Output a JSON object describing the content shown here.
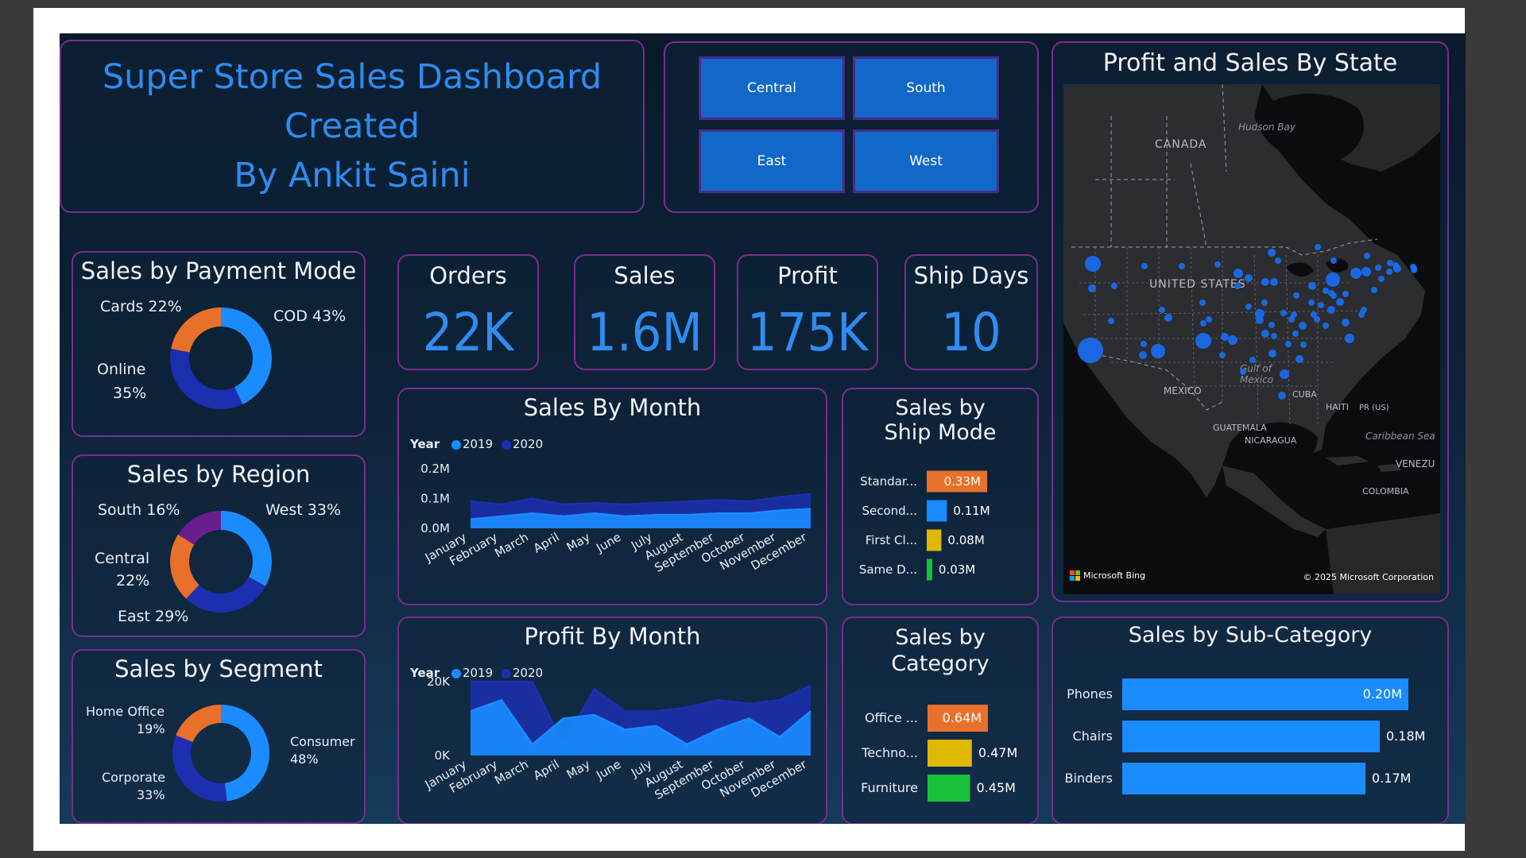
{
  "title": {
    "line1": "Super Store Sales Dashboard",
    "line2": "Created",
    "line3": "By Ankit Saini"
  },
  "region_slicer": {
    "buttons": [
      "Central",
      "South",
      "East",
      "West"
    ]
  },
  "kpis": [
    {
      "label": "Orders",
      "value": "22K"
    },
    {
      "label": "Sales",
      "value": "1.6M"
    },
    {
      "label": "Profit",
      "value": "175K"
    },
    {
      "label": "Ship Days",
      "value": "10"
    }
  ],
  "map": {
    "title": "Profit and Sales By State",
    "labels": {
      "canada": "CANADA",
      "hudson": "Hudson Bay",
      "us": "UNITED STATES",
      "gulf1": "Gulf of",
      "gulf2": "Mexico",
      "mexico": "MEXICO",
      "cuba": "CUBA",
      "haiti": "HAITI",
      "pr": "PR (US)",
      "guatemala": "GUATEMALA",
      "nicaragua": "NICARAGUA",
      "caribbean": "Caribbean Sea",
      "venezuela": "VENEZU",
      "colombia": "COLOMBIA"
    },
    "bing": "Microsoft Bing",
    "copyright": "© 2025 Microsoft Corporation"
  },
  "colors": {
    "series_2019": "#1a8cff",
    "series_2020": "#1c2fb0",
    "orange": "#e8702a",
    "purple": "#6a1e8c",
    "yellow": "#e0b800",
    "green": "#17c23a",
    "bar_blue": "#1a8cff"
  },
  "chart_data": [
    {
      "id": "payment",
      "type": "pie",
      "title": "Sales by Payment Mode",
      "slices": [
        {
          "name": "COD",
          "value": 43,
          "label": "COD 43%",
          "color": "#1a8cff"
        },
        {
          "name": "Online",
          "value": 35,
          "label_line1": "Online",
          "label_line2": "35%",
          "color": "#1c2fb0"
        },
        {
          "name": "Cards",
          "value": 22,
          "label": "Cards 22%",
          "color": "#e8702a"
        }
      ]
    },
    {
      "id": "region",
      "type": "pie",
      "title": "Sales by Region",
      "slices": [
        {
          "name": "West",
          "value": 33,
          "label": "West 33%",
          "color": "#1a8cff"
        },
        {
          "name": "East",
          "value": 29,
          "label": "East 29%",
          "color": "#1c2fb0"
        },
        {
          "name": "Central",
          "value": 22,
          "label_line1": "Central",
          "label_line2": "22%",
          "color": "#e8702a"
        },
        {
          "name": "South",
          "value": 16,
          "label": "South 16%",
          "color": "#6a1e8c"
        }
      ]
    },
    {
      "id": "segment",
      "type": "pie",
      "title": "Sales by Segment",
      "slices": [
        {
          "name": "Consumer",
          "value": 48,
          "label_line1": "Consumer",
          "label_line2": "48%",
          "color": "#1a8cff"
        },
        {
          "name": "Corporate",
          "value": 33,
          "label_line1": "Corporate",
          "label_line2": "33%",
          "color": "#1c2fb0"
        },
        {
          "name": "Home Office",
          "value": 19,
          "label_line1": "Home Office",
          "label_line2": "19%",
          "color": "#e8702a"
        }
      ]
    },
    {
      "id": "sales_month",
      "type": "area",
      "title": "Sales By Month",
      "legend_title": "Year",
      "categories": [
        "January",
        "February",
        "March",
        "April",
        "May",
        "June",
        "July",
        "August",
        "September",
        "October",
        "November",
        "December"
      ],
      "ytick_labels": [
        "0.2M",
        "0.1M",
        "0.0M"
      ],
      "yticks": [
        0.2,
        0.1,
        0.0
      ],
      "ylim": [
        0,
        0.2
      ],
      "series": [
        {
          "name": "2019",
          "values": [
            0.03,
            0.04,
            0.05,
            0.04,
            0.05,
            0.04,
            0.045,
            0.045,
            0.05,
            0.05,
            0.06,
            0.065
          ]
        },
        {
          "name": "2020",
          "values": [
            0.09,
            0.08,
            0.1,
            0.08,
            0.085,
            0.08,
            0.085,
            0.09,
            0.095,
            0.09,
            0.105,
            0.115
          ]
        }
      ]
    },
    {
      "id": "profit_month",
      "type": "area",
      "title": "Profit By Month",
      "legend_title": "Year",
      "categories": [
        "January",
        "February",
        "March",
        "April",
        "May",
        "June",
        "July",
        "August",
        "September",
        "October",
        "November",
        "December"
      ],
      "ytick_labels": [
        "20K",
        "0K"
      ],
      "yticks": [
        20,
        0
      ],
      "ylim": [
        0,
        20
      ],
      "series": [
        {
          "name": "2019",
          "values": [
            12,
            15,
            3,
            10,
            11,
            7,
            8,
            3,
            7,
            10,
            5,
            12
          ]
        },
        {
          "name": "2020",
          "values": [
            20,
            20,
            20,
            3,
            18,
            12,
            12,
            13,
            15,
            14,
            15,
            19
          ]
        }
      ]
    },
    {
      "id": "ship_mode",
      "type": "bar",
      "orientation": "horizontal",
      "title": "Sales by Ship Mode",
      "categories": [
        "Standar...",
        "Second...",
        "First Cl...",
        "Same D..."
      ],
      "values": [
        0.33,
        0.11,
        0.08,
        0.03
      ],
      "value_labels": [
        "0.33M",
        "0.11M",
        "0.08M",
        "0.03M"
      ],
      "colors": [
        "#e8702a",
        "#1a8cff",
        "#e0b800",
        "#17c23a"
      ]
    },
    {
      "id": "category",
      "type": "bar",
      "orientation": "horizontal",
      "title": "Sales by Category",
      "categories": [
        "Office ...",
        "Techno...",
        "Furniture"
      ],
      "values": [
        0.64,
        0.47,
        0.45
      ],
      "value_labels": [
        "0.64M",
        "0.47M",
        "0.45M"
      ],
      "colors": [
        "#e8702a",
        "#e0b800",
        "#17c23a"
      ]
    },
    {
      "id": "subcategory",
      "type": "bar",
      "orientation": "horizontal",
      "title": "Sales by Sub-Category",
      "categories": [
        "Phones",
        "Chairs",
        "Binders"
      ],
      "values": [
        0.2,
        0.18,
        0.17
      ],
      "value_labels": [
        "0.20M",
        "0.18M",
        "0.17M"
      ],
      "colors": [
        "#1a8cff",
        "#1a8cff",
        "#1a8cff"
      ]
    }
  ]
}
